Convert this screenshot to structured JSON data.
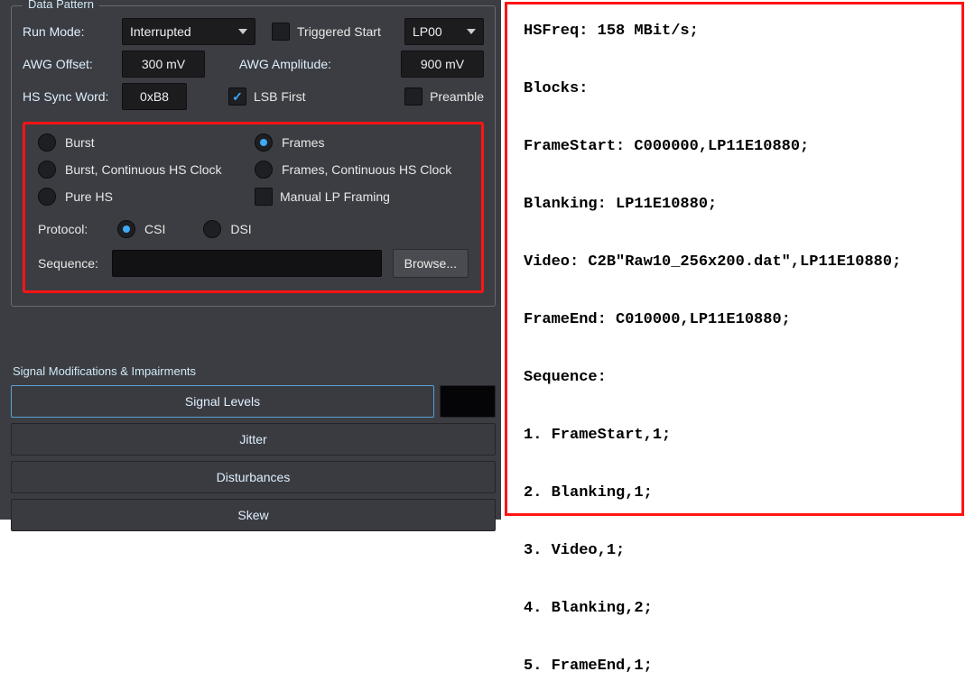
{
  "panel": {
    "title": "Data Pattern",
    "runMode": {
      "label": "Run Mode:",
      "value": "Interrupted"
    },
    "triggeredStart": {
      "label": "Triggered Start",
      "checked": false
    },
    "lpMode": {
      "value": "LP00"
    },
    "awgOffset": {
      "label": "AWG Offset:",
      "value": "300 mV"
    },
    "awgAmplitude": {
      "label": "AWG Amplitude:",
      "value": "900 mV"
    },
    "hsSync": {
      "label": "HS Sync Word:",
      "value": "0xB8"
    },
    "lsbFirst": {
      "label": "LSB First",
      "checked": true
    },
    "preamble": {
      "label": "Preamble",
      "checked": false
    }
  },
  "modes": {
    "burst": "Burst",
    "frames": "Frames",
    "burstCont": "Burst, Continuous HS Clock",
    "framesCont": "Frames, Continuous HS Clock",
    "pureHs": "Pure HS",
    "manualLp": "Manual LP Framing",
    "selected": "frames"
  },
  "protocol": {
    "label": "Protocol:",
    "csi": "CSI",
    "dsi": "DSI",
    "selected": "csi"
  },
  "sequence": {
    "label": "Sequence:",
    "value": "",
    "browse": "Browse..."
  },
  "smi": {
    "title": "Signal Modifications & Impairments",
    "rows": [
      "Signal Levels",
      "Jitter",
      "Disturbances",
      "Skew"
    ]
  },
  "script": {
    "lines": [
      "HSFreq: 158 MBit/s;",
      "",
      "Blocks:",
      "",
      "FrameStart: C000000,LP11E10880;",
      "",
      "Blanking: LP11E10880;",
      "",
      "Video: C2B\"Raw10_256x200.dat\",LP11E10880;",
      "",
      "FrameEnd: C010000,LP11E10880;",
      "",
      "Sequence:",
      "",
      "1. FrameStart,1;",
      "",
      "2. Blanking,1;",
      "",
      "3. Video,1;",
      "",
      "4. Blanking,2;",
      "",
      "5. FrameEnd,1;"
    ]
  }
}
